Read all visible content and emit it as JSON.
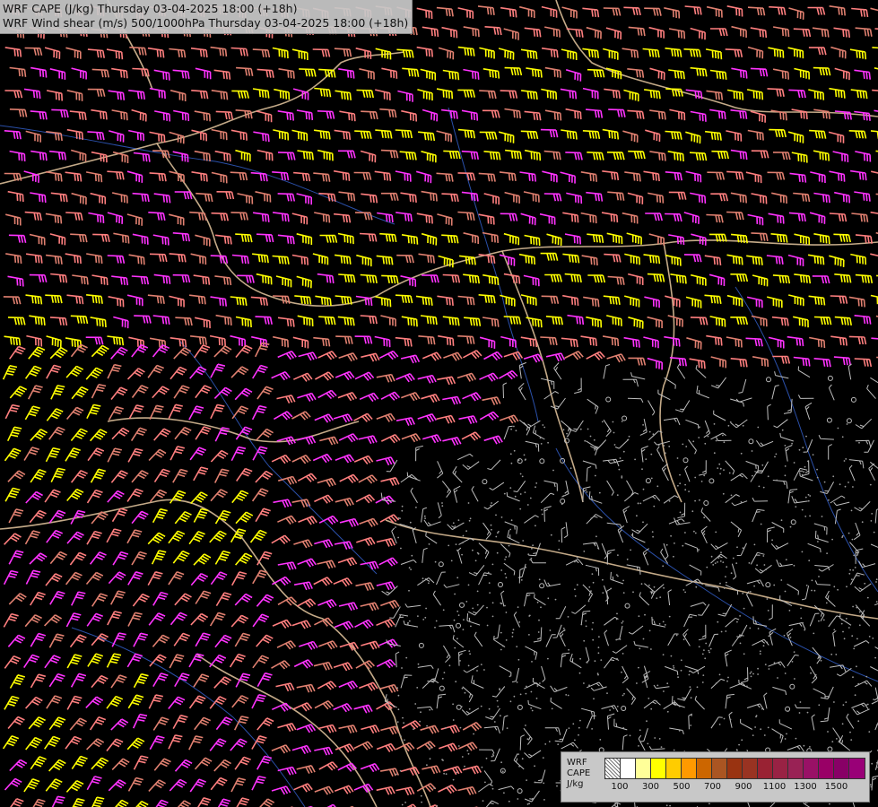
{
  "title": {
    "line1": "WRF CAPE (J/kg) Thursday 03-04-2025 18:00 (+18h)",
    "line2": "WRF Wind shear (m/s) 500/1000hPa Thursday 03-04-2025 18:00 (+18h)"
  },
  "legend": {
    "label_lines": [
      "WRF",
      "CAPE",
      "J/kg"
    ],
    "colors": [
      "#d0d0d0",
      "#ffffff",
      "#ffff99",
      "#ffff00",
      "#ffcc00",
      "#ff9900",
      "#cc6600",
      "#aa5522",
      "#993311",
      "#993322",
      "#992233",
      "#992244",
      "#992255",
      "#991166",
      "#990066",
      "#880066",
      "#990077"
    ],
    "tick_labels": [
      "100",
      "300",
      "500",
      "700",
      "900",
      "1100",
      "1300",
      "1500"
    ]
  },
  "map": {
    "shear_colors": {
      "low": "#bdbdbd",
      "medium": "#e08070",
      "high": "#ff7f7f",
      "strong": "#ff33ff",
      "very_strong": "#ffff00"
    }
  }
}
